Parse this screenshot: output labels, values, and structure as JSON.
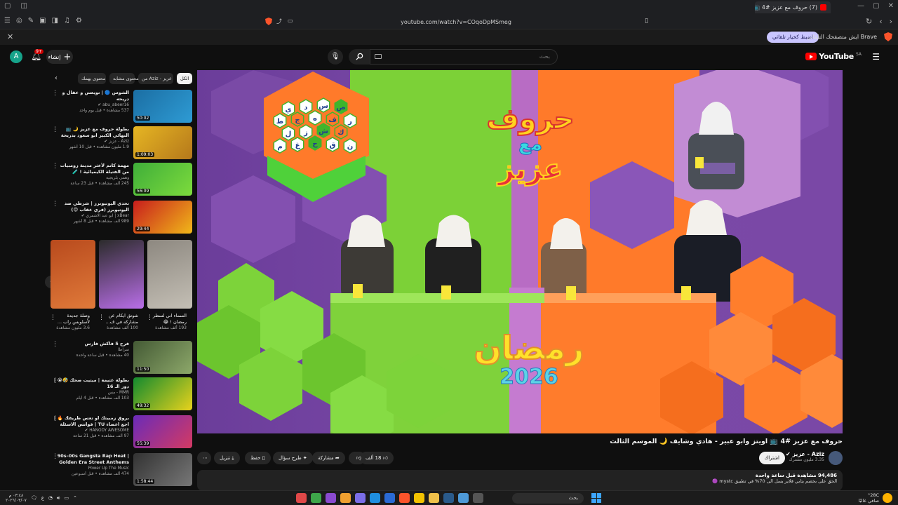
{
  "browser": {
    "tab_title": "(7) حروف مع عزيز #4 📺 اويتز وا...",
    "url": "youtube.com/watch?v=COqoDpMSmeg",
    "infobar_message": "Brave ايش متصفحك التلقائي",
    "infobar_button": "اضبط كخيار تلقائي"
  },
  "youtube": {
    "avatar_letter": "A",
    "notifications": "9+",
    "create_label": "إنشاء",
    "search_placeholder": "بحث",
    "logo_word": "YouTube",
    "logo_cc": "SA"
  },
  "chips": [
    "الكل",
    "من Aziz - عزيز",
    "محتوى مشابه",
    "محتوى يهمك"
  ],
  "recommendations": [
    {
      "title": "الشوس 🔵 | تويعس و عقال و دريحه",
      "channel": "abu_abeer16 ✔",
      "meta": "537 مشاهدة • قبل يوم واحد",
      "duration": "50:02",
      "colors": [
        "#1b6ea3",
        "#2e9bd4"
      ]
    },
    {
      "title": "بطولة حروف مع عزيز 🌙 📺 النهائي الكبير ابو سعود بدريحة ضد عثمان وعامر",
      "channel": "Aziz - عزيز ✔",
      "meta": "1.9 مليون مشاهدة • قبل 10 أشهر",
      "duration": "1:09:03",
      "colors": [
        "#e6b623",
        "#b5781b"
      ]
    },
    {
      "title": "مهمة كاتم لأعثر مدينة زومبيات من الفتيلة الكيميائية ! 🧪",
      "channel": "وهمي بلريجية",
      "meta": "245 ألف مشاهدة • قبل 23 ساعة",
      "duration": "56:09",
      "colors": [
        "#3fae3a",
        "#7ddb3c"
      ]
    },
    {
      "title": "تحدي اليوتيوبرز | شرطي ضد اليوتيوبرز (فري عقاب 😡)",
      "channel": "xBear | ابو عبد الاشمري ✔",
      "meta": "989 ألف مشاهدة • قبل 8 أشهر",
      "duration": "29:44",
      "colors": [
        "#c81d1d",
        "#f0b819"
      ]
    },
    {
      "title": "فرح 5 فاكش فارس",
      "channel": "سراطا",
      "meta": "40 مشاهدة • قبل ساعة واحدة",
      "duration": "11:50",
      "colors": [
        "#445a35",
        "#8da86a"
      ]
    },
    {
      "title": "بطولة عتيمة | ميتيت ضحك 🤣😭 | دور الـ 16",
      "channel": "MMR - مس",
      "meta": "103 ألف مشاهدة • قبل 4 أيام",
      "duration": "49:32",
      "colors": [
        "#138a2f",
        "#e8d21c"
      ]
    },
    {
      "title": "بروق زمبيتك او تعس ظريفك 🔥 | اجع اعضاء TU | فوانس الاسئلة 1#",
      "channel": "HANODY AWESOME ✔",
      "meta": "97 ألف مشاهدة • قبل 21 ساعة",
      "duration": "55:39",
      "colors": [
        "#6a2bb8",
        "#d43a63"
      ]
    },
    {
      "title": "90s–00s Gangsta Rap Heat | Golden Era Street Anthems Only",
      "channel": "Power Up The Music",
      "meta": "474 ألف مشاهدة • قبل أسبوعين",
      "duration": "1:58:44",
      "colors": [
        "#333333",
        "#777777"
      ]
    }
  ],
  "shorts": [
    {
      "title": "السماء اني لسطر رمضان ! 😂",
      "views": "193 ألف مشاهدة",
      "colors": [
        "#8d8880",
        "#c4bfb5"
      ]
    },
    {
      "title": "شوتق ايكام عن مشاركه في ف...",
      "views": "100 ألف مشاهدة",
      "colors": [
        "#2b2b2b",
        "#b96ee8"
      ]
    },
    {
      "title": "وصلة جديدة لأسلوبس راب ...",
      "views": "3.6 مليون مشاهدة",
      "colors": [
        "#b84a1d",
        "#e07a3a"
      ]
    }
  ],
  "video": {
    "title": "حروف مع عزيز #4 📺 اويتز وابو عبير - هادي وشايف 🌙 الموسم الثالث",
    "channel": "Aziz - عزيز ✔",
    "subscribers": "3.35 مليون مشترك",
    "subscribe_label": "اشتراك",
    "like_count": "18 ألف",
    "share_label": "مشاركة",
    "ask_label": "طرح سؤال",
    "save_label": "حفظ",
    "download_label": "تنزيل",
    "more_label": "⋯",
    "views_line": "94,486 مشاهدة قبل ساعة واحدة",
    "desc_line": "الحق على بخصم يتابي قلاير يسل الى 70% في تطبيق mystc 🟣",
    "logo_top": [
      "حروف",
      "مع",
      "عزيز"
    ],
    "logo_bottom": [
      "رمضان",
      "2026"
    ],
    "letters": [
      "ي",
      "د",
      "س",
      "ص",
      "ط",
      "ج",
      "ه",
      "ف",
      "ر",
      "ل",
      "ز",
      "ش",
      "ك",
      "م",
      "غ",
      "ح",
      "ق",
      "ن"
    ]
  },
  "taskbar": {
    "search_placeholder": "بحث",
    "time": "٠٣:٤٨ م",
    "date": "٢٠٢٦/٠٣/٠٧",
    "temperature": "°28C",
    "weather": "صافي غالبًا"
  }
}
